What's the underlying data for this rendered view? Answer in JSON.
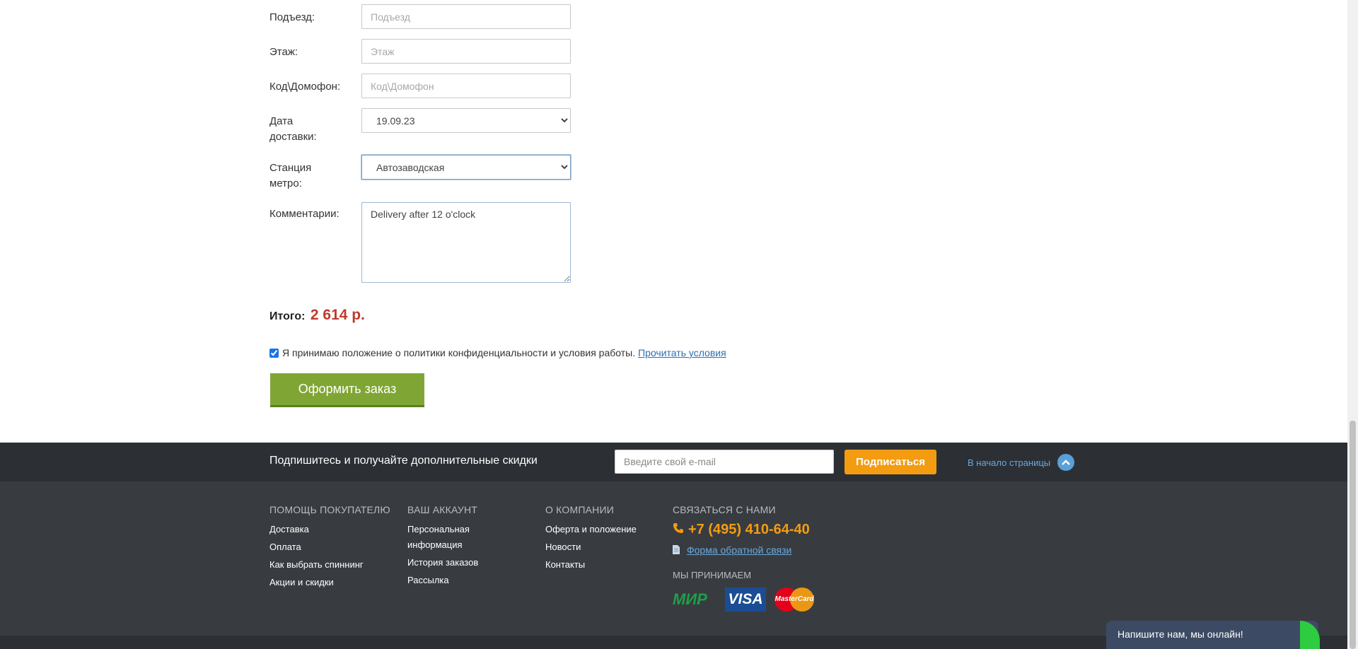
{
  "form": {
    "entrance": {
      "label": "Подъезд:",
      "placeholder": "Подъезд"
    },
    "floor": {
      "label": "Этаж:",
      "placeholder": "Этаж"
    },
    "intercom": {
      "label": "Код\\Домофон:",
      "placeholder": "Код\\Домофон"
    },
    "delivery_date": {
      "label": "Дата доставки:",
      "value": "19.09.23"
    },
    "metro": {
      "label": "Станция метро:",
      "value": "Автозаводская"
    },
    "comments": {
      "label": "Комментарии:",
      "value": "Delivery after 12 o'clock"
    }
  },
  "total": {
    "label": "Итого:",
    "amount": "2 614 р."
  },
  "agreement": {
    "text": "Я принимаю положение о политики конфиденциальности и условия работы.",
    "link": "Прочитать условия",
    "checked": true
  },
  "order_button": "Оформить заказ",
  "subscribe": {
    "text": "Подпишитесь и получайте дополнительные скидки",
    "placeholder": "Введите свой e-mail",
    "button": "Подписаться",
    "to_top": "В начало страницы"
  },
  "footer": {
    "help": {
      "title": "ПОМОЩЬ ПОКУПАТЕЛЮ",
      "links": [
        "Доставка",
        "Оплата",
        "Как выбрать спиннинг",
        "Акции и скидки"
      ]
    },
    "account": {
      "title": "ВАШ АККАУНТ",
      "links": [
        "Персональная информация",
        "История заказов",
        "Рассылка"
      ]
    },
    "company": {
      "title": "О КОМПАНИИ",
      "links": [
        "Оферта и положение",
        "Новости",
        "Контакты"
      ]
    },
    "contact": {
      "title": "СВЯЗАТЬСЯ С НАМИ",
      "phone": "+7 (495) 410-64-40",
      "feedback": "Форма обратной связи",
      "we_accept": "МЫ ПРИНИМАЕМ"
    },
    "payments": {
      "mir": "МИР",
      "visa": "VISA",
      "mastercard": "MasterCard"
    }
  },
  "chat": {
    "text": "Напишите нам, мы онлайн!"
  },
  "colors": {
    "accent_green": "#7fa634",
    "orange": "#f39c12",
    "price_red": "#c0392b",
    "footer_bg": "#383c40"
  }
}
